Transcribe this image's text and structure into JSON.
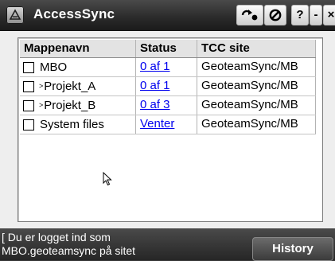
{
  "window": {
    "title": "AccessSync",
    "buttons": {
      "sync_icon": "sync-arrow-icon",
      "block_icon": "no-entry-icon",
      "help_label": "?",
      "minimize_label": "-",
      "close_label": "×"
    }
  },
  "table": {
    "columns": [
      "Mappenavn",
      "Status",
      "TCC site"
    ],
    "rows": [
      {
        "prefix": "",
        "name": "MBO",
        "status": "0 af 1",
        "site": "GeoteamSync/MB"
      },
      {
        "prefix": "˃",
        "name": "Projekt_A",
        "status": "0 af 1",
        "site": "GeoteamSync/MB"
      },
      {
        "prefix": "˃",
        "name": "Projekt_B",
        "status": "0 af 3",
        "site": "GeoteamSync/MB"
      },
      {
        "prefix": "",
        "name": "System files",
        "status": "Venter",
        "site": "GeoteamSync/MB"
      }
    ]
  },
  "footer": {
    "status_line1": "[ Du er logget ind som",
    "status_line2": "MBO.geoteamsync på sitet",
    "history_label": "History"
  },
  "colors": {
    "link": "#0000ee",
    "titlebar": "#2c2c2c",
    "client_background": "#eeeeee"
  }
}
